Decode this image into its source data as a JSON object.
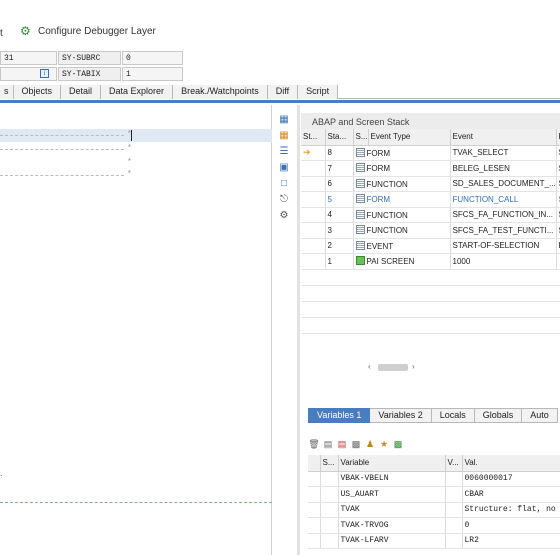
{
  "toolbar": {
    "left_fragment": "t",
    "configure_label": "Configure Debugger Layer"
  },
  "sys_fields": [
    {
      "value": "31",
      "label": "SY-SUBRC",
      "field_value": "0"
    },
    {
      "value": "",
      "label": "SY-TABIX",
      "field_value": "1"
    }
  ],
  "main_tabs": [
    "s",
    "Objects",
    "Detail",
    "Data Explorer",
    "Break./Watchpoints",
    "Diff",
    "Script"
  ],
  "editor": {
    "star": "*",
    "fragment": "."
  },
  "stack": {
    "title": "ABAP and Screen Stack",
    "columns": [
      "St...",
      "Sta...",
      "S...",
      "Event Type",
      "Event",
      "F"
    ],
    "rows": [
      {
        "level": "8",
        "event_type": "FORM",
        "event": "TVAK_SELECT",
        "prog": "S",
        "current": true,
        "icon": "list"
      },
      {
        "level": "7",
        "event_type": "FORM",
        "event": "BELEG_LESEN",
        "prog": "S",
        "current": false,
        "icon": "list"
      },
      {
        "level": "6",
        "event_type": "FUNCTION",
        "event": "SD_SALES_DOCUMENT_...",
        "prog": "S",
        "current": false,
        "icon": "list"
      },
      {
        "level": "5",
        "event_type": "FORM",
        "event": "FUNCTION_CALL",
        "prog": "S",
        "current": false,
        "highlight": true,
        "icon": "list"
      },
      {
        "level": "4",
        "event_type": "FUNCTION",
        "event": "SFCS_FA_FUNCTION_IN...",
        "prog": "S",
        "current": false,
        "icon": "list"
      },
      {
        "level": "3",
        "event_type": "FUNCTION",
        "event": "SFCS_FA_TEST_FUNCTI...",
        "prog": "S",
        "current": false,
        "icon": "list"
      },
      {
        "level": "2",
        "event_type": "EVENT",
        "event": "START-OF-SELECTION",
        "prog": "R",
        "current": false,
        "icon": "list"
      },
      {
        "level": "1",
        "event_type": "PAI SCREEN",
        "event": "1000",
        "prog": "",
        "current": false,
        "icon": "screen"
      }
    ]
  },
  "var_tabs": [
    "Variables 1",
    "Variables 2",
    "Locals",
    "Globals",
    "Auto"
  ],
  "variables": {
    "columns": [
      "S...",
      "Variable",
      "V...",
      "Val."
    ],
    "rows": [
      {
        "name": "VBAK-VBELN",
        "value": "0060000017"
      },
      {
        "name": "US_AUART",
        "value": "CBAR"
      },
      {
        "name": "TVAK",
        "value": "Structure: flat, no"
      },
      {
        "name": "TVAK-TRVOG",
        "value": "0"
      },
      {
        "name": "TVAK-LFARV",
        "value": "LR2"
      }
    ]
  }
}
